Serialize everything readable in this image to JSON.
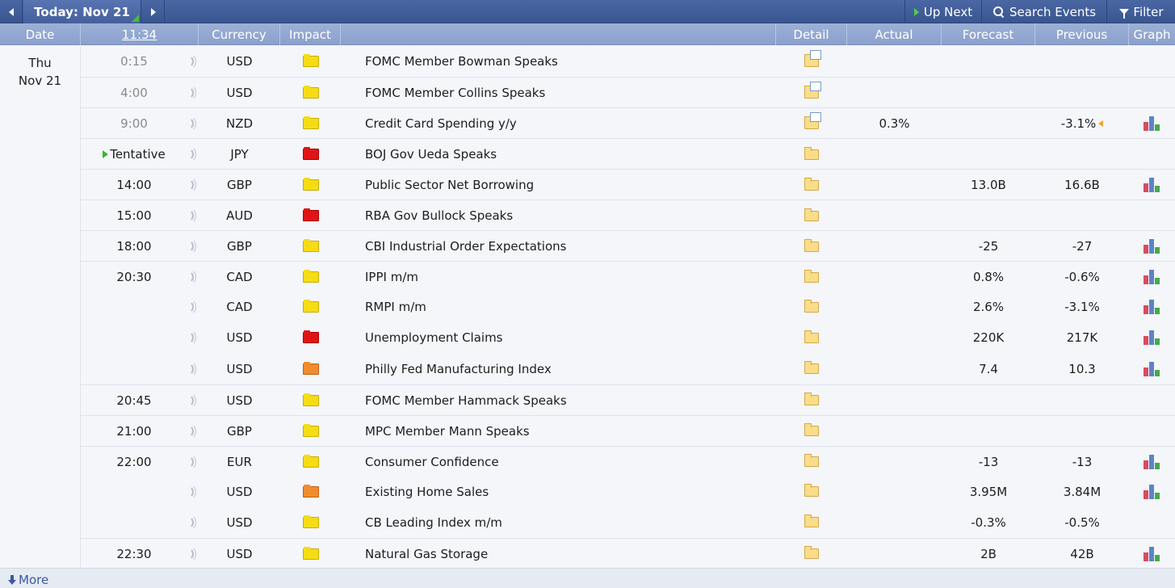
{
  "toolbar": {
    "today_label": "Today: Nov 21",
    "up_next_label": "Up Next",
    "search_label": "Search Events",
    "filter_label": "Filter"
  },
  "header": {
    "date": "Date",
    "time": "11:34",
    "currency": "Currency",
    "impact": "Impact",
    "detail": "Detail",
    "actual": "Actual",
    "forecast": "Forecast",
    "previous": "Previous",
    "graph": "Graph"
  },
  "day": {
    "weekday": "Thu",
    "date": "Nov 21"
  },
  "rows": [
    {
      "time": "0:15",
      "past": true,
      "currency": "USD",
      "impact": "yellow",
      "event": "FOMC Member Bowman Speaks",
      "detail": "detail-open-icon",
      "actual": "",
      "forecast": "",
      "previous": "",
      "graph": false,
      "sep": true
    },
    {
      "time": "4:00",
      "past": true,
      "currency": "USD",
      "impact": "yellow",
      "event": "FOMC Member Collins Speaks",
      "detail": "detail-open-icon",
      "actual": "",
      "forecast": "",
      "previous": "",
      "graph": false,
      "sep": true
    },
    {
      "time": "9:00",
      "past": true,
      "currency": "NZD",
      "impact": "yellow",
      "event": "Credit Card Spending y/y",
      "detail": "detail-open-icon",
      "actual": "0.3%",
      "forecast": "",
      "previous": "-3.1%",
      "revised": true,
      "graph": true,
      "sep": true
    },
    {
      "time": "Tentative",
      "tentative": true,
      "currency": "JPY",
      "impact": "red",
      "event": "BOJ Gov Ueda Speaks",
      "detail": "folder-icon",
      "actual": "",
      "forecast": "",
      "previous": "",
      "graph": false,
      "sep": true
    },
    {
      "time": "14:00",
      "currency": "GBP",
      "impact": "yellow",
      "event": "Public Sector Net Borrowing",
      "detail": "folder-icon",
      "actual": "",
      "forecast": "13.0B",
      "previous": "16.6B",
      "graph": true,
      "sep": true
    },
    {
      "time": "15:00",
      "currency": "AUD",
      "impact": "red",
      "event": "RBA Gov Bullock Speaks",
      "detail": "folder-icon",
      "actual": "",
      "forecast": "",
      "previous": "",
      "graph": false,
      "sep": true
    },
    {
      "time": "18:00",
      "currency": "GBP",
      "impact": "yellow",
      "event": "CBI Industrial Order Expectations",
      "detail": "folder-icon",
      "actual": "",
      "forecast": "-25",
      "previous": "-27",
      "graph": true,
      "sep": true
    },
    {
      "time": "20:30",
      "currency": "CAD",
      "impact": "yellow",
      "event": "IPPI m/m",
      "detail": "folder-icon",
      "actual": "",
      "forecast": "0.8%",
      "previous": "-0.6%",
      "graph": true,
      "sep": true
    },
    {
      "time": "",
      "currency": "CAD",
      "impact": "yellow",
      "event": "RMPI m/m",
      "detail": "folder-icon",
      "actual": "",
      "forecast": "2.6%",
      "previous": "-3.1%",
      "graph": true,
      "sep": false
    },
    {
      "time": "",
      "currency": "USD",
      "impact": "red",
      "event": "Unemployment Claims",
      "detail": "folder-icon",
      "actual": "",
      "forecast": "220K",
      "previous": "217K",
      "graph": true,
      "sep": false
    },
    {
      "time": "",
      "currency": "USD",
      "impact": "orange",
      "event": "Philly Fed Manufacturing Index",
      "detail": "folder-icon",
      "actual": "",
      "forecast": "7.4",
      "previous": "10.3",
      "graph": true,
      "sep": false
    },
    {
      "time": "20:45",
      "currency": "USD",
      "impact": "yellow",
      "event": "FOMC Member Hammack Speaks",
      "detail": "folder-icon",
      "actual": "",
      "forecast": "",
      "previous": "",
      "graph": false,
      "sep": true
    },
    {
      "time": "21:00",
      "currency": "GBP",
      "impact": "yellow",
      "event": "MPC Member Mann Speaks",
      "detail": "folder-icon",
      "actual": "",
      "forecast": "",
      "previous": "",
      "graph": false,
      "sep": true
    },
    {
      "time": "22:00",
      "currency": "EUR",
      "impact": "yellow",
      "event": "Consumer Confidence",
      "detail": "folder-icon",
      "actual": "",
      "forecast": "-13",
      "previous": "-13",
      "graph": true,
      "sep": true
    },
    {
      "time": "",
      "currency": "USD",
      "impact": "orange",
      "event": "Existing Home Sales",
      "detail": "folder-icon",
      "actual": "",
      "forecast": "3.95M",
      "previous": "3.84M",
      "graph": true,
      "sep": false
    },
    {
      "time": "",
      "currency": "USD",
      "impact": "yellow",
      "event": "CB Leading Index m/m",
      "detail": "folder-icon",
      "actual": "",
      "forecast": "-0.3%",
      "previous": "-0.5%",
      "graph": false,
      "sep": false
    },
    {
      "time": "22:30",
      "currency": "USD",
      "impact": "yellow",
      "event": "Natural Gas Storage",
      "detail": "folder-icon",
      "actual": "",
      "forecast": "2B",
      "previous": "42B",
      "graph": true,
      "sep": true
    }
  ],
  "footer": {
    "more_label": "More"
  },
  "colors": {
    "impact_yellow": "#f6dc13",
    "impact_red": "#e01414",
    "impact_orange": "#f28b2c",
    "toolbar": "#3a5690",
    "header": "#8ba0cc"
  }
}
